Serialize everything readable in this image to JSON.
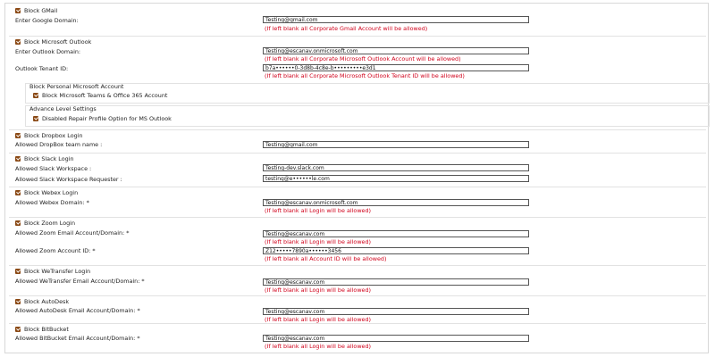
{
  "sections": [
    {
      "id": "gmail",
      "checkbox": "Block GMail",
      "fields": [
        {
          "label": "Enter Google Domain:",
          "value": "Testing@gmail.com",
          "note": "(If left blank all Corporate Gmail Account will be allowed)"
        }
      ]
    },
    {
      "id": "outlook",
      "checkbox": "Block Microsoft Outlook",
      "fields": [
        {
          "label": "Enter Outlook Domain:",
          "value": "Testing@escanav.onmicrosoft.com",
          "note": "(If left blank all Corporate Microsoft Outlook Account will be allowed)"
        },
        {
          "label": "Outlook Tenant ID:",
          "value": "b7a••••••0-3d8b-4c8e-b•••••••••e3d1",
          "note": "(If left blank all Corporate Microsoft Outlook Tenant ID will be allowed)"
        }
      ],
      "personal": {
        "title": "Block Personal Microsoft Account",
        "checkbox": "Block Microsoft Teams & Office 365 Account"
      },
      "advance": {
        "title": "Advance Level Settings",
        "checkbox": "Disabled Repair Profile Option for MS Outlook"
      }
    },
    {
      "id": "dropbox",
      "checkbox": "Block Dropbox Login",
      "fields": [
        {
          "label": "Allowed DropBox team name :",
          "value": "Testing@gmail.com"
        }
      ]
    },
    {
      "id": "slack",
      "checkbox": "Block Slack Login",
      "fields": [
        {
          "label": "Allowed Slack Workspace :",
          "value": "Testing-dev.slack.com"
        },
        {
          "label": "Allowed Slack Workspace Requester :",
          "value": "testing@e••••••le.com"
        }
      ]
    },
    {
      "id": "webex",
      "checkbox": "Block Webex Login",
      "fields": [
        {
          "label": "Allowed Webex Domain: *",
          "value": "Testing@escanav.onmicrosoft.com",
          "note": "(If left blank all Login will be allowed)"
        }
      ]
    },
    {
      "id": "zoom",
      "checkbox": "Block Zoom Login",
      "fields": [
        {
          "label": "Allowed Zoom Email Account/Domain: *",
          "value": "Testing@escanav.com",
          "note": "(If left blank all Login will be allowed)"
        },
        {
          "label": "Allowed Zoom Account ID: *",
          "value": "Z12•••••7890a••••••3456",
          "note": "(If left blank all Account ID will be allowed)"
        }
      ]
    },
    {
      "id": "wetransfer",
      "checkbox": "Block WeTransfer Login",
      "fields": [
        {
          "label": "Allowed WeTransfer Email Account/Domain: *",
          "value": "Testing@escanav.com",
          "note": "(If left blank all Login will be allowed)"
        }
      ]
    },
    {
      "id": "autodesk",
      "checkbox": "Block AutoDesk",
      "fields": [
        {
          "label": "Allowed AutoDesk Email Account/Domain: *",
          "value": "Testing@escanav.com",
          "note": "(If left blank all Login will be allowed)"
        }
      ]
    },
    {
      "id": "bitbucket",
      "checkbox": "Block BitBucket",
      "fields": [
        {
          "label": "Allowed BitBucket Email Account/Domain: *",
          "value": "Testing@escanav.com",
          "note": "(If left blank all Login will be allowed)"
        }
      ]
    }
  ],
  "colors": {
    "checkbox": "#8b4a16",
    "note": "#d0021b",
    "border": "#e2e2e2"
  }
}
